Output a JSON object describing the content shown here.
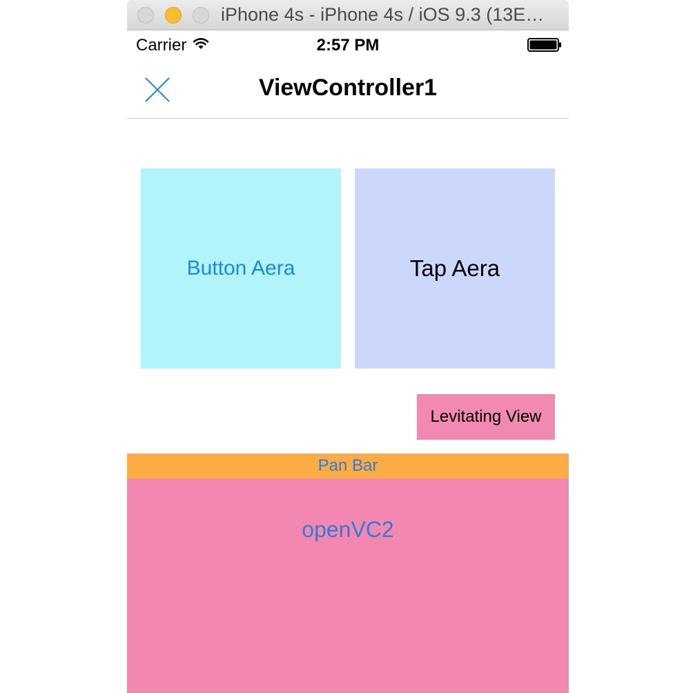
{
  "window": {
    "title": "iPhone 4s - iPhone 4s / iOS 9.3 (13E…"
  },
  "status_bar": {
    "carrier": "Carrier",
    "time": "2:57 PM",
    "wifi_icon": "wifi-icon",
    "battery_icon": "battery-full-icon"
  },
  "nav": {
    "title": "ViewController1",
    "close_icon": "close-icon"
  },
  "main": {
    "button_area_label": "Button Aera",
    "tap_area_label": "Tap Aera",
    "levitating_label": "Levitating View",
    "pan_bar_label": "Pan Bar",
    "open_vc2_label": "openVC2"
  },
  "colors": {
    "button_area_bg": "#b1f5fb",
    "tap_area_bg": "#cbd8fc",
    "levitating_bg": "#f289b1",
    "pan_bar_bg": "#fbac44",
    "bottom_panel_bg": "#f288b1",
    "tint": "#1b86f1"
  }
}
